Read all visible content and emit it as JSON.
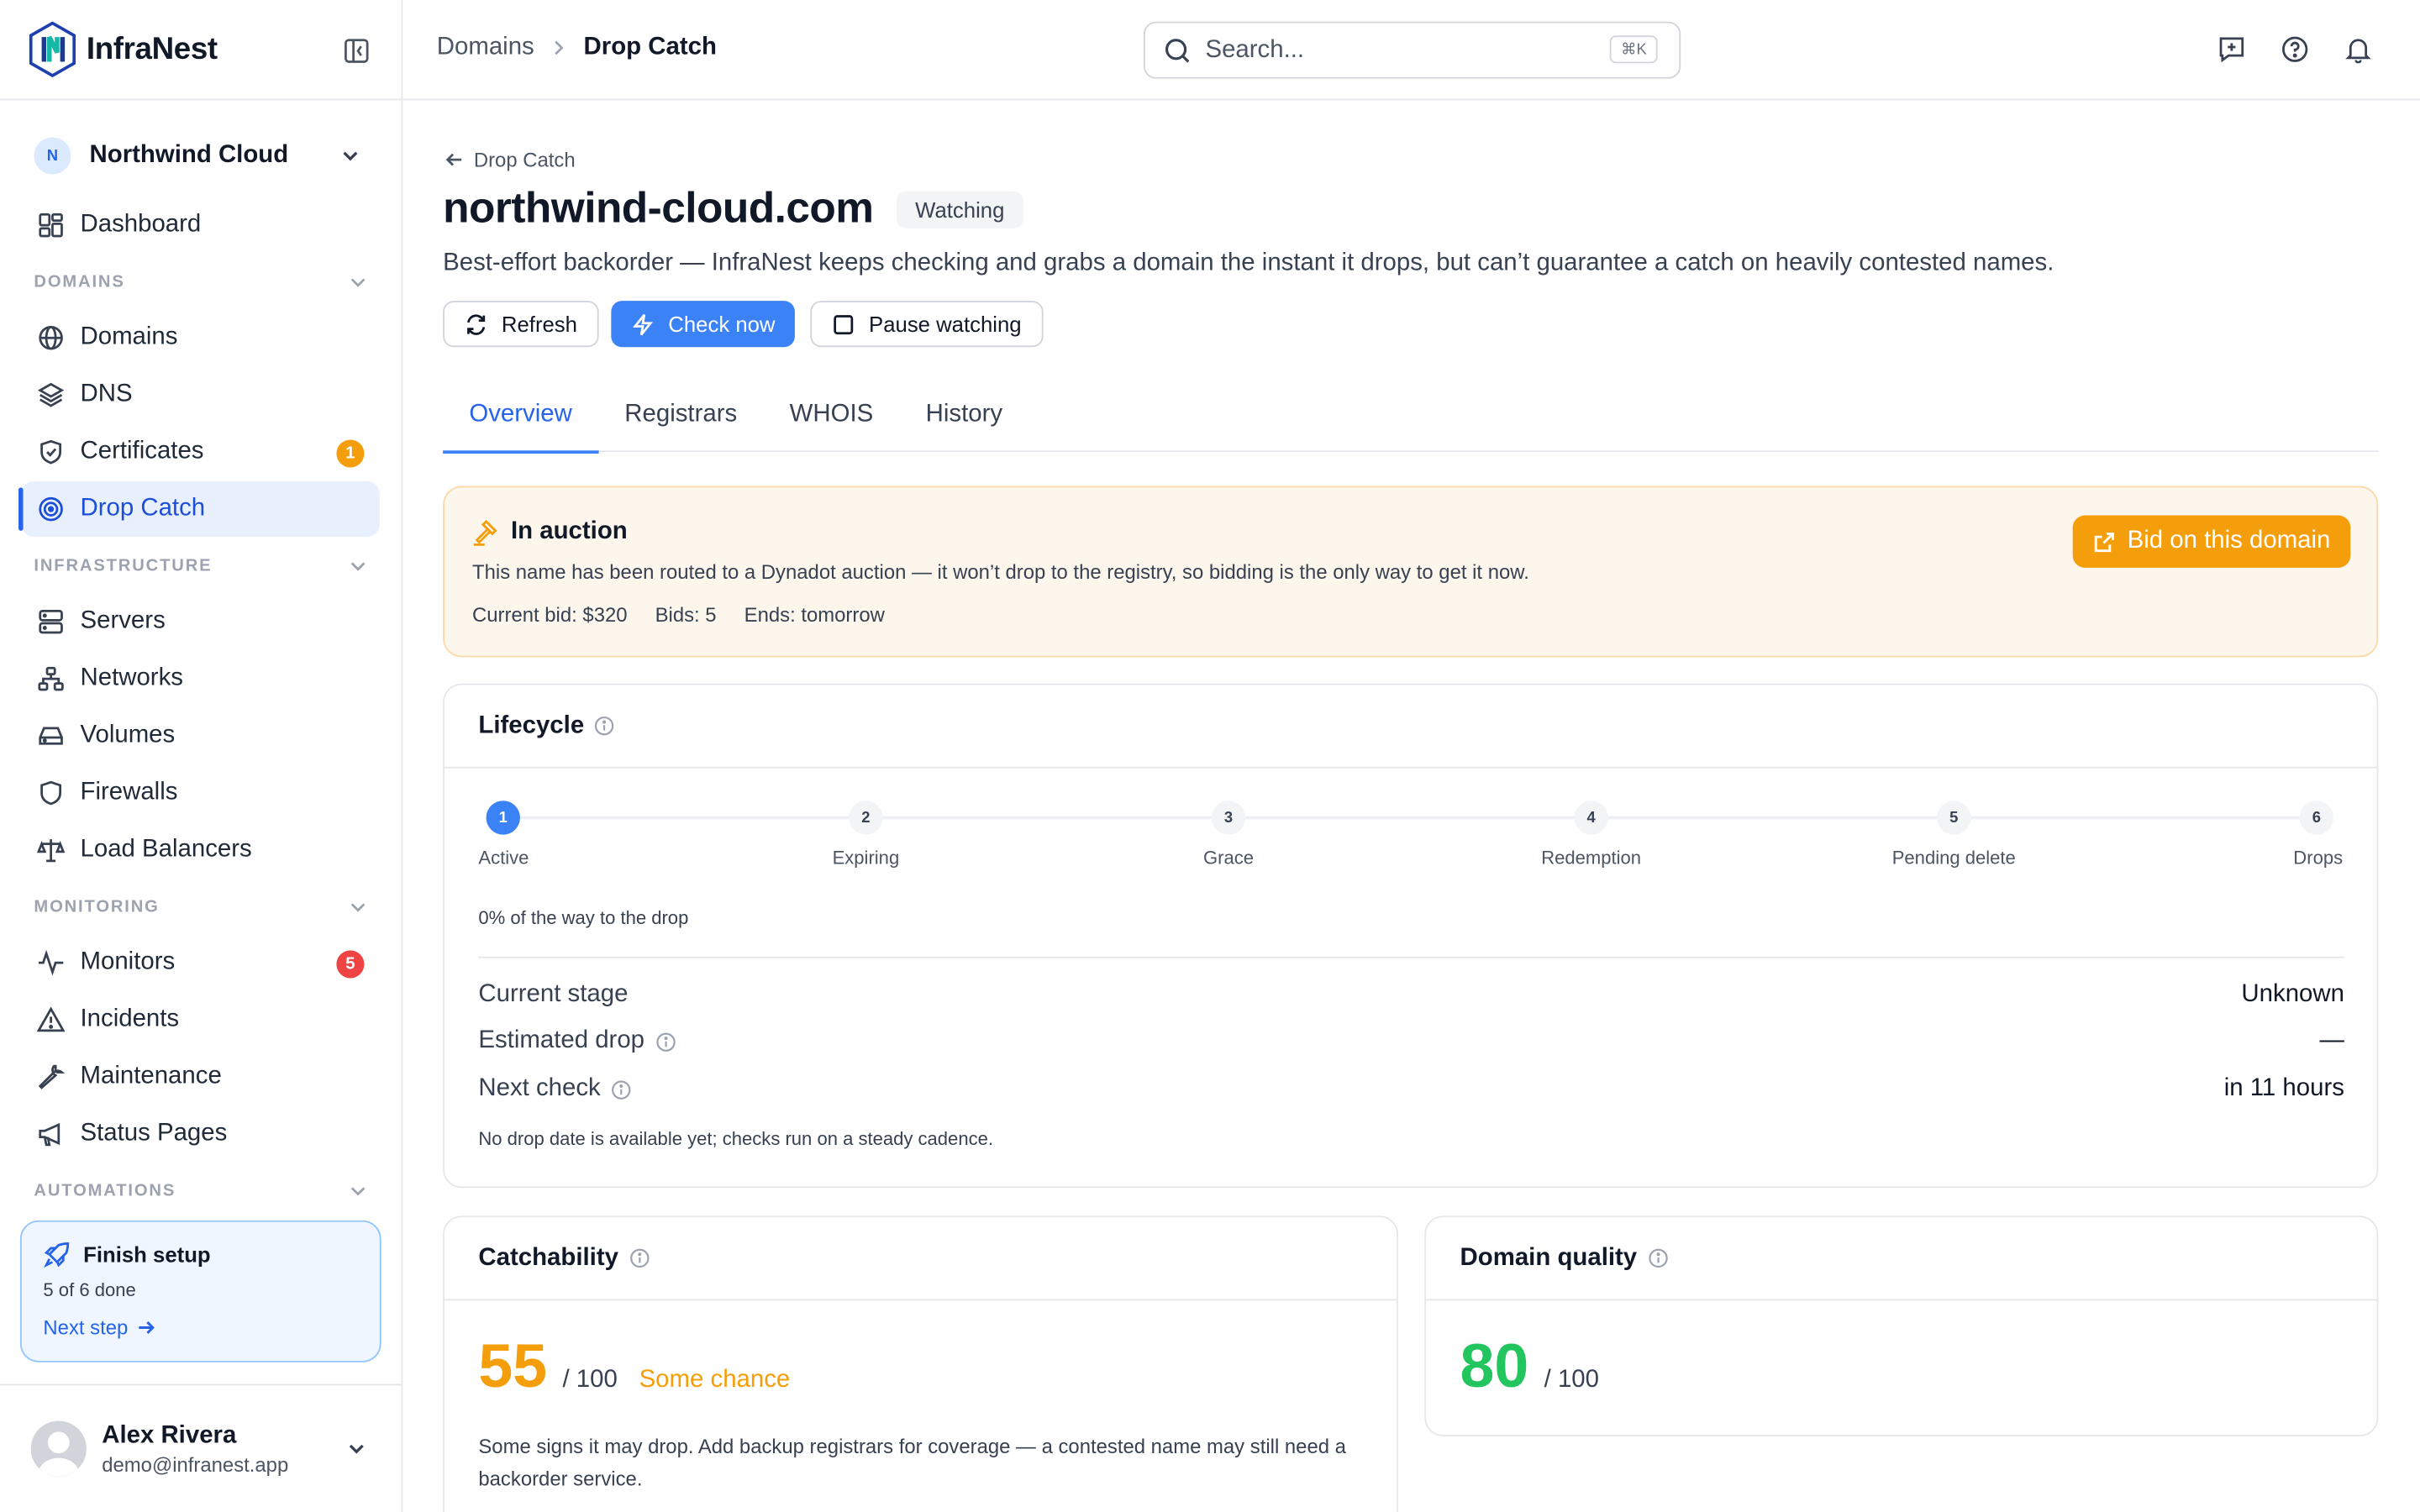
{
  "brand": {
    "name": "InfraNest"
  },
  "org": {
    "initial": "N",
    "name": "Northwind Cloud"
  },
  "nav": {
    "dashboard": "Dashboard",
    "sections": {
      "domains": "DOMAINS",
      "infrastructure": "INFRASTRUCTURE",
      "monitoring": "MONITORING",
      "automations": "AUTOMATIONS"
    },
    "domains": "Domains",
    "dns": "DNS",
    "certificates": "Certificates",
    "certificates_badge": "1",
    "drop_catch": "Drop Catch",
    "servers": "Servers",
    "networks": "Networks",
    "volumes": "Volumes",
    "firewalls": "Firewalls",
    "load_balancers": "Load Balancers",
    "monitors": "Monitors",
    "monitors_badge": "5",
    "incidents": "Incidents",
    "maintenance": "Maintenance",
    "status_pages": "Status Pages"
  },
  "setup": {
    "title": "Finish setup",
    "progress": "5 of 6 done",
    "link": "Next step"
  },
  "user": {
    "name": "Alex Rivera",
    "email": "demo@infranest.app"
  },
  "topbar": {
    "crumb_parent": "Domains",
    "crumb_current": "Drop Catch",
    "search_placeholder": "Search...",
    "search_shortcut": "⌘K"
  },
  "page": {
    "back_label": "Drop Catch",
    "title": "northwind-cloud.com",
    "status": "Watching",
    "description": "Best-effort backorder — InfraNest keeps checking and grabs a domain the instant it drops, but can’t guarantee a catch on heavily contested names.",
    "buttons": {
      "refresh": "Refresh",
      "check_now": "Check now",
      "pause": "Pause watching"
    },
    "tabs": [
      "Overview",
      "Registrars",
      "WHOIS",
      "History"
    ],
    "active_tab": "Overview"
  },
  "auction": {
    "title": "In auction",
    "description": "This name has been routed to a Dynadot auction — it won’t drop to the registry, so bidding is the only way to get it now.",
    "current_bid": "Current bid: $320",
    "bids": "Bids: 5",
    "ends": "Ends: tomorrow",
    "button": "Bid on this domain"
  },
  "lifecycle": {
    "title": "Lifecycle",
    "steps": [
      {
        "num": "1",
        "label": "Active"
      },
      {
        "num": "2",
        "label": "Expiring"
      },
      {
        "num": "3",
        "label": "Grace"
      },
      {
        "num": "4",
        "label": "Redemption"
      },
      {
        "num": "5",
        "label": "Pending delete"
      },
      {
        "num": "6",
        "label": "Drops"
      }
    ],
    "current_step": 1,
    "progress_text": "0% of the way to the drop",
    "current_stage_label": "Current stage",
    "current_stage_value": "Unknown",
    "estimated_drop_label": "Estimated drop",
    "estimated_drop_value": "—",
    "next_check_label": "Next check",
    "next_check_value": "in 11 hours",
    "note": "No drop date is available yet; checks run on a steady cadence."
  },
  "catchability": {
    "title": "Catchability",
    "score": "55",
    "max": "/ 100",
    "label": "Some chance",
    "note": "Some signs it may drop. Add backup registrars for coverage — a contested name may still need a backorder service.",
    "color": "#f59e0b"
  },
  "quality": {
    "title": "Domain quality",
    "score": "80",
    "max": "/ 100",
    "color": "#22c55e"
  },
  "colors": {
    "accent": "#3b82f6",
    "warning": "#f59e0b",
    "danger": "#ef4444",
    "success": "#22c55e"
  }
}
